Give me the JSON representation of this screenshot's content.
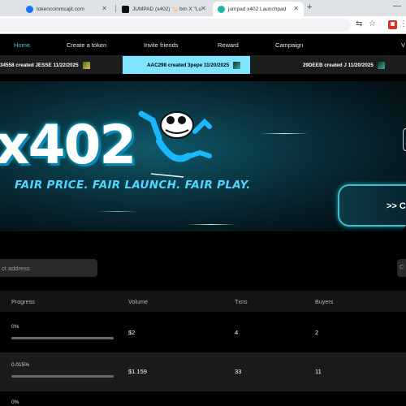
{
  "browser": {
    "tabs": [
      {
        "title": "tokencoinmcajit.com",
        "active": false,
        "favicon_color": "#1f6fff"
      },
      {
        "title": "JUMPAD (x402) 🏷️ brn X \"Lu",
        "active": false,
        "favicon_color": "#111111"
      },
      {
        "title": "jumpad x402 Launchpad",
        "active": true,
        "favicon_color": "#1fb6a6"
      }
    ],
    "new_tab_label": "+",
    "minimize_label": "—"
  },
  "nav": {
    "items": [
      "Home",
      "Create a token",
      "Invite friends",
      "Reward",
      "Campaign",
      "V"
    ],
    "active_index": 0
  },
  "ticker": [
    {
      "text": "34558  created JESSE  11/22/2025"
    },
    {
      "text": "AAC298  created 3pepe  11/20/2025"
    },
    {
      "text": "29DEEB  created J  11/20/2025"
    }
  ],
  "hero": {
    "title": "x402",
    "tagline": "FAIR PRICE. FAIR LAUNCH. FAIR PLAY.",
    "cta_label": ">> C"
  },
  "search": {
    "placeholder": "ct address",
    "right_label": "C"
  },
  "table": {
    "headers": [
      "Progress",
      "Volume",
      "Txns",
      "Buyers"
    ],
    "rows": [
      {
        "progress_label": "0%",
        "progress_value": 0,
        "volume": "$2",
        "txns": "4",
        "buyers": "2"
      },
      {
        "progress_label": "0.015%",
        "progress_value": 0.015,
        "volume": "$1.159",
        "txns": "33",
        "buyers": "11"
      },
      {
        "progress_label": "0%",
        "progress_value": 0,
        "volume": "",
        "txns": "",
        "buyers": ""
      }
    ]
  },
  "colors": {
    "accent": "#4fc9e8",
    "ticker_highlight": "#7ee4ff",
    "hero_cyan": "#4fd6ff"
  }
}
